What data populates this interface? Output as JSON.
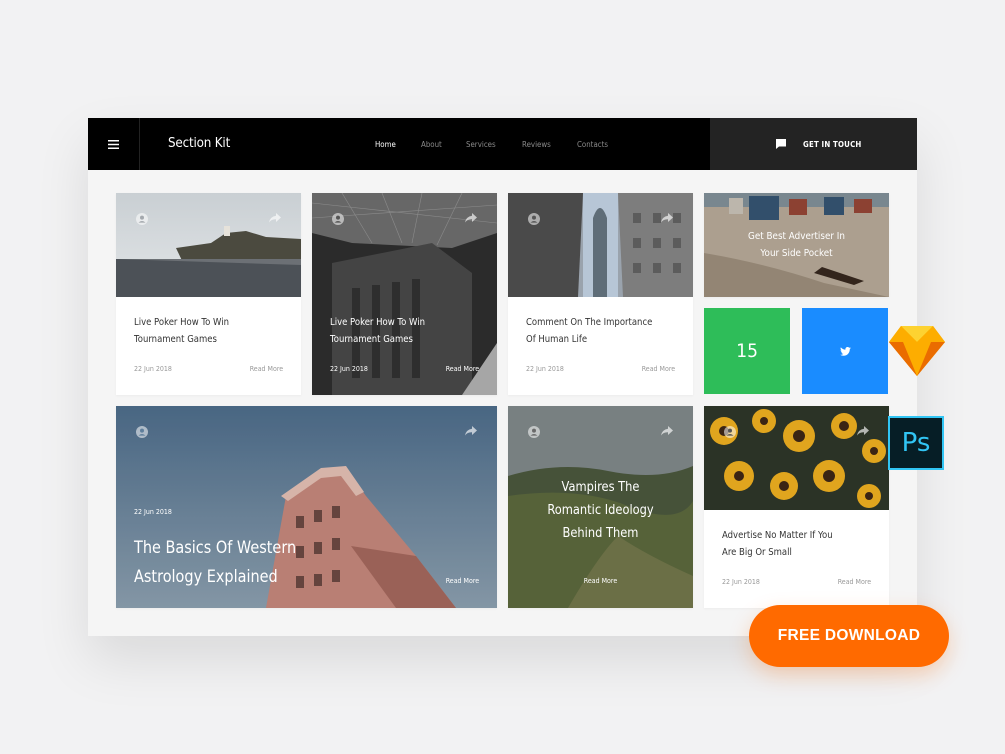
{
  "app": {
    "brand": "Section Kit",
    "nav": [
      {
        "label": "Home",
        "active": true
      },
      {
        "label": "About",
        "active": false
      },
      {
        "label": "Services",
        "active": false
      },
      {
        "label": "Reviews",
        "active": false
      },
      {
        "label": "Contacts",
        "active": false
      }
    ],
    "touch_label": "GET IN TOUCH",
    "icons": {
      "menu": "hamburger-icon",
      "chat": "chat-icon",
      "user": "user-icon",
      "share": "share-icon",
      "twitter": "twitter-icon"
    }
  },
  "cards": [
    {
      "title_lines": [
        "Live Poker How To Win",
        "Tournament Games"
      ],
      "date": "22 Jun 2018",
      "more": "Read More"
    },
    {
      "title_lines": [
        "Live Poker How To Win",
        "Tournament Games"
      ],
      "date": "22 Jun 2018",
      "more": "Read More"
    },
    {
      "title_lines": [
        "Comment On The Importance",
        "Of Human Life"
      ],
      "date": "22 Jun 2018",
      "more": "Read More"
    },
    {
      "title_lines": [
        "Get Best Advertiser In",
        "Your Side Pocket"
      ]
    },
    {
      "title_lines": [
        "The Basics Of Western",
        "Astrology Explained"
      ],
      "date": "22 Jun 2018",
      "more": "Read More"
    },
    {
      "title_lines": [
        "Vampires The",
        "Romantic Ideology",
        "Behind Them"
      ],
      "more": "Read More"
    },
    {
      "title_lines": [
        "Advertise No Matter If You",
        "Are Big Or Small"
      ],
      "date": "22 Jun 2018",
      "more": "Read More"
    }
  ],
  "tiles": {
    "count": "15",
    "count_color": "#2ebd59",
    "twitter_color": "#1a8cff"
  },
  "badges": {
    "sketch": "sketch-icon",
    "photoshop": "Ps"
  },
  "cta": {
    "label": "FREE DOWNLOAD",
    "color": "#ff6a00"
  }
}
